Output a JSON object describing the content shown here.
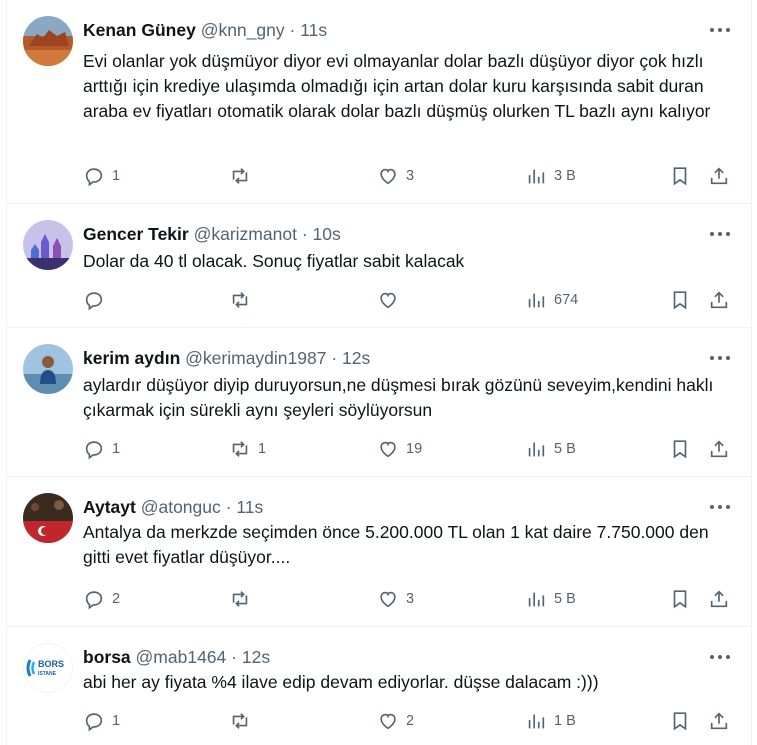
{
  "tweets": [
    {
      "name": "Kenan Güney",
      "handle": "@knn_gny",
      "time": "11s",
      "text": "Evi olanlar yok düşmüyor diyor evi olmayanlar dolar bazlı düşüyor diyor çok hızlı arttığı için krediye ulaşımda olmadığı için artan dolar kuru karşısında sabit duran araba ev fiyatları otomatik olarak dolar bazlı düşmüş olurken TL bazlı aynı kalıyor",
      "replies": "1",
      "reposts": "",
      "likes": "3",
      "views": "3 B"
    },
    {
      "name": "Gencer Tekir",
      "handle": "@karizmanot",
      "time": "10s",
      "text": "Dolar da 40 tl olacak. Sonuç fiyatlar sabit kalacak",
      "replies": "",
      "reposts": "",
      "likes": "",
      "views": "674"
    },
    {
      "name": "kerim aydın",
      "handle": "@kerimaydin1987",
      "time": "12s",
      "text": "aylardır düşüyor diyip duruyorsun,ne düşmesi bırak gözünü seveyim,kendini haklı çıkarmak için sürekli aynı şeyleri söylüyorsun",
      "replies": "1",
      "reposts": "1",
      "likes": "19",
      "views": "5 B"
    },
    {
      "name": "Aytayt",
      "handle": "@atonguc",
      "time": "11s",
      "text": "Antalya da merkzde seçimden önce 5.200.000 TL olan 1 kat daire 7.750.000 den gitti  evet fiyatlar düşüyor....",
      "replies": "2",
      "reposts": "",
      "likes": "3",
      "views": "5 B"
    },
    {
      "name": "borsa",
      "handle": "@mab1464",
      "time": "12s",
      "text": "abi her ay fiyata %4 ilave edip devam ediyorlar. düşse dalacam :)))",
      "replies": "1",
      "reposts": "",
      "likes": "2",
      "views": "1 B"
    }
  ],
  "avatar5_text": [
    "BORS",
    "ISTANE"
  ],
  "separator": "·",
  "colors": {
    "text": "#0f1419",
    "muted": "#536471",
    "border": "#eff3f4"
  }
}
